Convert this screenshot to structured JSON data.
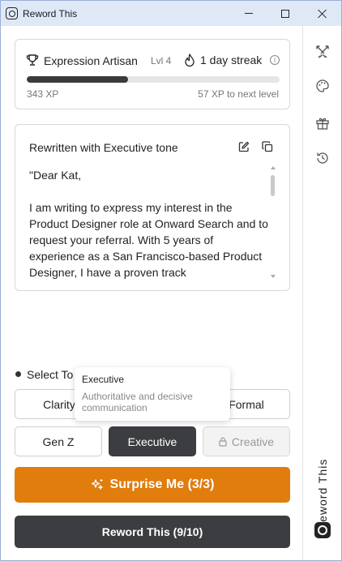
{
  "window": {
    "title": "Reword This"
  },
  "xp": {
    "title": "Expression Artisan",
    "level": "Lvl 4",
    "streak": "1 day streak",
    "info_icon": "i",
    "progress": 0.4,
    "xp_current": "343 XP",
    "xp_next": "57 XP to next level"
  },
  "output": {
    "title": "Rewritten with Executive tone",
    "text": "\"Dear Kat,\n\nI am writing to express my interest in the Product Designer role at Onward Search and to request your referral. With 5 years of experience as a San Francisco-based Product Designer, I have a proven track"
  },
  "tones": {
    "label": "Select To",
    "buttons": [
      {
        "label": "Clarity"
      },
      {
        "label": "Formal"
      },
      {
        "label": "Gen Z"
      },
      {
        "label": "Executive"
      },
      {
        "label": "Creative"
      }
    ]
  },
  "tooltip": {
    "title": "Executive",
    "description": "Authoritative and decisive communication"
  },
  "actions": {
    "surprise": "Surprise Me (3/3)",
    "reword": "Reword This (9/10)"
  },
  "sidebar": {
    "vertical_label": "Reword This",
    "icons": [
      "swords-icon",
      "palette-icon",
      "gift-icon",
      "history-icon"
    ]
  },
  "colors": {
    "accent_orange": "#e07d0c",
    "dark_button": "#3c3d40",
    "titlebar": "#dfe8f7"
  }
}
